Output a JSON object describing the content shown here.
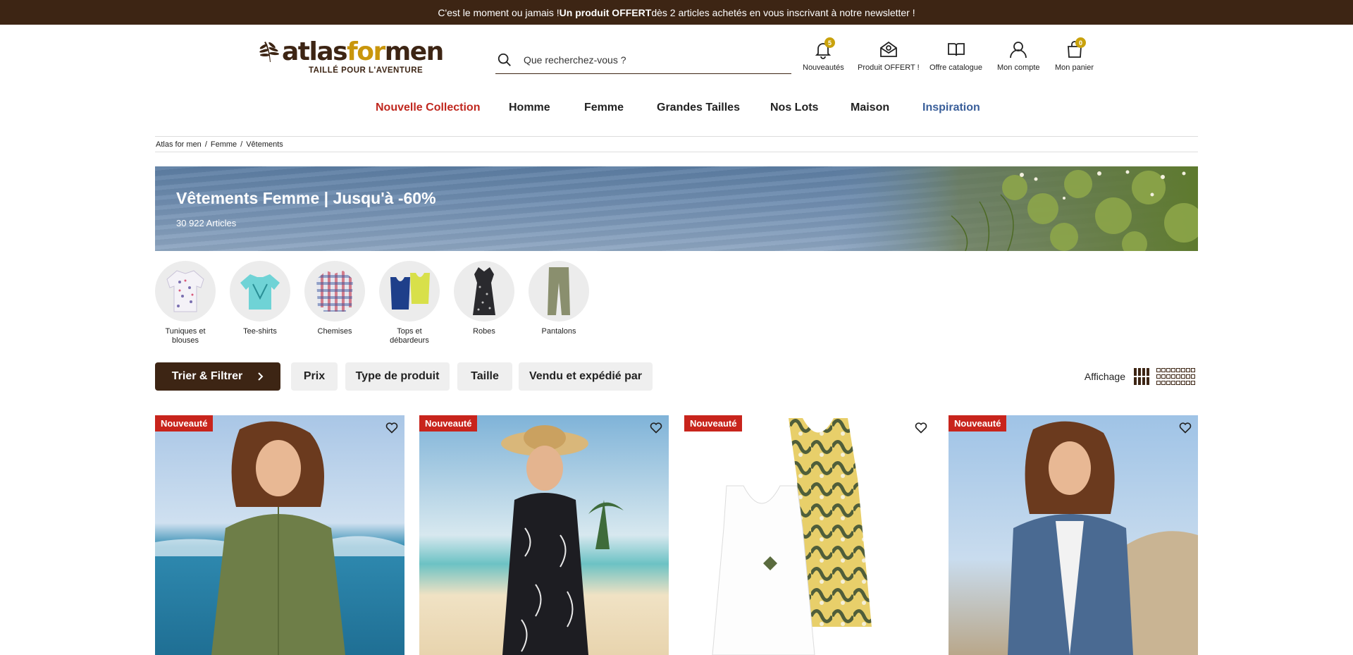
{
  "promo": {
    "part1": "C'est le moment ou jamais ! ",
    "bold": "Un produit OFFERT",
    "part2": " dès 2 articles achetés en vous inscrivant à notre newsletter !"
  },
  "logo": {
    "word_a": "atlas",
    "word_b": "for",
    "word_c": "men",
    "tagline": "TAILLÉ POUR L'AVENTURE"
  },
  "search": {
    "placeholder": "Que recherchez-vous ?"
  },
  "header_icons": [
    {
      "label": "Nouveautés",
      "icon": "bell-icon",
      "badge": "5"
    },
    {
      "label": "Produit OFFERT !",
      "icon": "gift-envelope-icon",
      "badge": ""
    },
    {
      "label": "Offre catalogue",
      "icon": "book-icon",
      "badge": ""
    },
    {
      "label": "Mon compte",
      "icon": "user-icon",
      "badge": ""
    },
    {
      "label": "Mon panier",
      "icon": "bag-icon",
      "badge": "0"
    }
  ],
  "nav": [
    "Nouvelle Collection",
    "Homme",
    "Femme",
    "Grandes Tailles",
    "Nos Lots",
    "Maison",
    "Inspiration"
  ],
  "colors": {
    "brand_brown": "#3d2514",
    "gold": "#c9960c",
    "red": "#c8241c",
    "nav_new": "#c0281f",
    "nav_inspiration": "#3a5f9a"
  },
  "breadcrumb": [
    "Atlas for men",
    "Femme",
    "Vêtements"
  ],
  "banner": {
    "title": "Vêtements Femme | Jusqu'à -60%",
    "count": "30 922 Articles"
  },
  "categories": [
    {
      "label": "Tuniques et blouses"
    },
    {
      "label": "Tee-shirts"
    },
    {
      "label": "Chemises"
    },
    {
      "label": "Tops et débardeurs"
    },
    {
      "label": "Robes"
    },
    {
      "label": "Pantalons"
    }
  ],
  "filters": {
    "main": "Trier & Filtrer",
    "chips": [
      "Prix",
      "Type de produit",
      "Taille",
      "Vendu et expédié par"
    ]
  },
  "display": {
    "label": "Affichage"
  },
  "products": [
    {
      "badge": "Nouveauté"
    },
    {
      "badge": "Nouveauté"
    },
    {
      "badge": "Nouveauté"
    },
    {
      "badge": "Nouveauté"
    }
  ]
}
